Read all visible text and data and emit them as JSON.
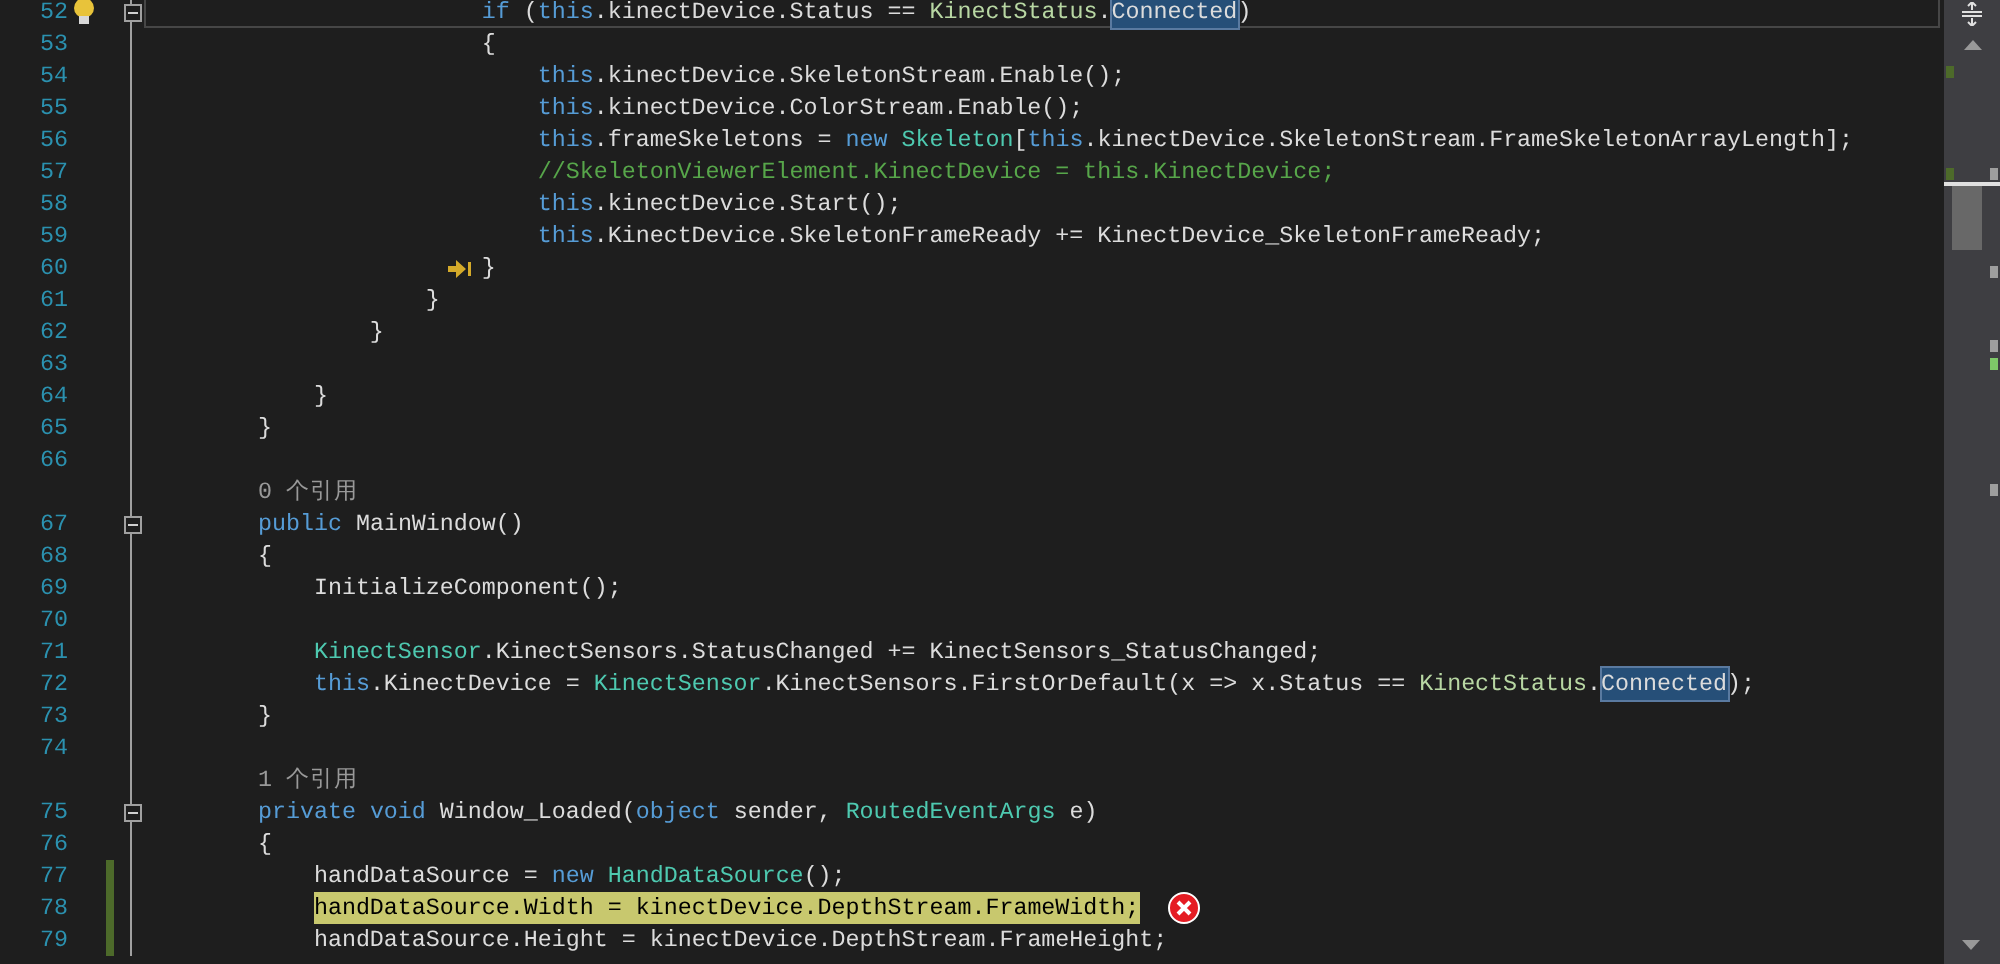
{
  "editor": {
    "lines": [
      {
        "kind": "code",
        "number": "52",
        "current": true,
        "lightbulb": true,
        "foldable": true,
        "tokens": [
          {
            "kind": "keyword",
            "text": "                        if"
          },
          {
            "kind": "plain",
            "text": " ("
          },
          {
            "kind": "keyword",
            "text": "this"
          },
          {
            "kind": "plain",
            "text": ".kinectDevice.Status == "
          },
          {
            "kind": "enum",
            "text": "KinectStatus"
          },
          {
            "kind": "plain",
            "text": "."
          },
          {
            "kind": "selection",
            "text": "Connected"
          },
          {
            "kind": "plain",
            "text": ")"
          }
        ]
      },
      {
        "kind": "code",
        "number": "53",
        "tokens": [
          {
            "kind": "plain",
            "text": "                        {"
          }
        ]
      },
      {
        "kind": "code",
        "number": "54",
        "tokens": [
          {
            "kind": "keyword",
            "text": "                            this"
          },
          {
            "kind": "plain",
            "text": ".kinectDevice.SkeletonStream.Enable();"
          }
        ]
      },
      {
        "kind": "code",
        "number": "55",
        "tokens": [
          {
            "kind": "keyword",
            "text": "                            this"
          },
          {
            "kind": "plain",
            "text": ".kinectDevice.ColorStream.Enable();"
          }
        ]
      },
      {
        "kind": "code",
        "number": "56",
        "tokens": [
          {
            "kind": "keyword",
            "text": "                            this"
          },
          {
            "kind": "plain",
            "text": ".frameSkeletons = "
          },
          {
            "kind": "keyword",
            "text": "new"
          },
          {
            "kind": "type",
            "text": " Skeleton"
          },
          {
            "kind": "plain",
            "text": "["
          },
          {
            "kind": "keyword",
            "text": "this"
          },
          {
            "kind": "plain",
            "text": ".kinectDevice.SkeletonStream.FrameSkeletonArrayLength];"
          }
        ]
      },
      {
        "kind": "code",
        "number": "57",
        "tokens": [
          {
            "kind": "comment",
            "text": "                            //SkeletonViewerElement.KinectDevice = this.KinectDevice;"
          }
        ]
      },
      {
        "kind": "code",
        "number": "58",
        "tokens": [
          {
            "kind": "keyword",
            "text": "                            this"
          },
          {
            "kind": "plain",
            "text": ".kinectDevice.Start();"
          }
        ]
      },
      {
        "kind": "code",
        "number": "59",
        "tokens": [
          {
            "kind": "keyword",
            "text": "                            this"
          },
          {
            "kind": "plain",
            "text": ".KinectDevice.SkeletonFrameReady += KinectDevice_SkeletonFrameReady;"
          }
        ]
      },
      {
        "kind": "code",
        "number": "60",
        "step_arrow": true,
        "tokens": [
          {
            "kind": "plain",
            "text": "                        }"
          }
        ]
      },
      {
        "kind": "code",
        "number": "61",
        "tokens": [
          {
            "kind": "plain",
            "text": "                    }"
          }
        ]
      },
      {
        "kind": "code",
        "number": "62",
        "tokens": [
          {
            "kind": "plain",
            "text": "                }"
          }
        ]
      },
      {
        "kind": "code",
        "number": "63"
      },
      {
        "kind": "code",
        "number": "64",
        "tokens": [
          {
            "kind": "plain",
            "text": "            }"
          }
        ]
      },
      {
        "kind": "code",
        "number": "65",
        "tokens": [
          {
            "kind": "plain",
            "text": "        }"
          }
        ]
      },
      {
        "kind": "code",
        "number": "66"
      },
      {
        "kind": "lens",
        "text": "0 个引用"
      },
      {
        "kind": "code",
        "number": "67",
        "foldable": true,
        "tokens": [
          {
            "kind": "keyword",
            "text": "        public"
          },
          {
            "kind": "plain",
            "text": " MainWindow()"
          }
        ]
      },
      {
        "kind": "code",
        "number": "68",
        "tokens": [
          {
            "kind": "plain",
            "text": "        {"
          }
        ]
      },
      {
        "kind": "code",
        "number": "69",
        "tokens": [
          {
            "kind": "plain",
            "text": "            InitializeComponent();"
          }
        ]
      },
      {
        "kind": "code",
        "number": "70"
      },
      {
        "kind": "code",
        "number": "71",
        "tokens": [
          {
            "kind": "type",
            "text": "            KinectSensor"
          },
          {
            "kind": "plain",
            "text": ".KinectSensors.StatusChanged += KinectSensors_StatusChanged;"
          }
        ]
      },
      {
        "kind": "code",
        "number": "72",
        "tokens": [
          {
            "kind": "keyword",
            "text": "            this"
          },
          {
            "kind": "plain",
            "text": ".KinectDevice = "
          },
          {
            "kind": "type",
            "text": "KinectSensor"
          },
          {
            "kind": "plain",
            "text": ".KinectSensors.FirstOrDefault(x => x.Status == "
          },
          {
            "kind": "enum",
            "text": "KinectStatus"
          },
          {
            "kind": "plain",
            "text": "."
          },
          {
            "kind": "selection",
            "text": "Connected"
          },
          {
            "kind": "plain",
            "text": ");"
          }
        ]
      },
      {
        "kind": "code",
        "number": "73",
        "tokens": [
          {
            "kind": "plain",
            "text": "        }"
          }
        ]
      },
      {
        "kind": "code",
        "number": "74"
      },
      {
        "kind": "lens",
        "text": "1 个引用"
      },
      {
        "kind": "code",
        "number": "75",
        "foldable": true,
        "tokens": [
          {
            "kind": "keyword",
            "text": "        private"
          },
          {
            "kind": "keyword",
            "text": " void"
          },
          {
            "kind": "plain",
            "text": " Window_Loaded("
          },
          {
            "kind": "keyword",
            "text": "object"
          },
          {
            "kind": "plain",
            "text": " sender, "
          },
          {
            "kind": "type",
            "text": "RoutedEventArgs"
          },
          {
            "kind": "plain",
            "text": " e)"
          }
        ]
      },
      {
        "kind": "code",
        "number": "76",
        "tokens": [
          {
            "kind": "plain",
            "text": "        {"
          }
        ]
      },
      {
        "kind": "code",
        "number": "77",
        "changed": true,
        "tokens": [
          {
            "kind": "plain",
            "text": "            handDataSource = "
          },
          {
            "kind": "keyword",
            "text": "new"
          },
          {
            "kind": "type",
            "text": " HandDataSource"
          },
          {
            "kind": "plain",
            "text": "();"
          }
        ]
      },
      {
        "kind": "code",
        "number": "78",
        "changed": true,
        "error": true,
        "tokens": [
          {
            "kind": "highlight",
            "text": "            handDataSource.Width = kinectDevice.DepthStream.FrameWidth;"
          }
        ]
      },
      {
        "kind": "code",
        "number": "79",
        "changed": true,
        "tokens": [
          {
            "kind": "plain",
            "text": "            handDataSource.Height = kinectDevice.DepthStream.FrameHeight;"
          }
        ]
      }
    ]
  }
}
